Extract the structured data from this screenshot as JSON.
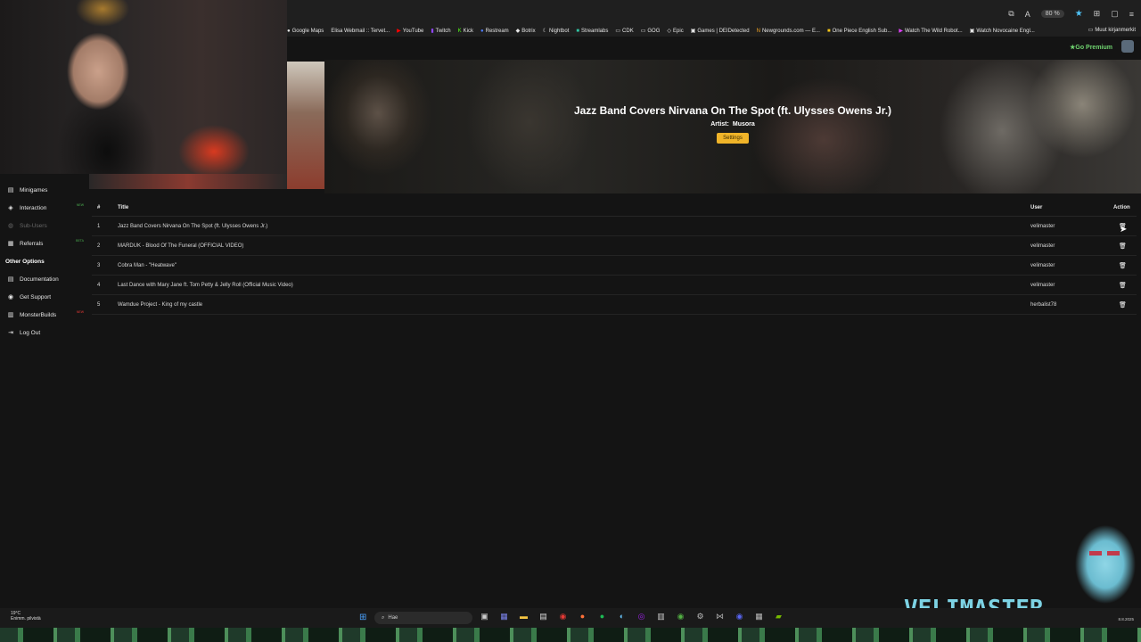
{
  "browser": {
    "zoom": "80 %",
    "bookmarks": [
      "Google Maps",
      "Elisa Webmail :: Tervet...",
      "YouTube",
      "Twitch",
      "Kick",
      "Restream",
      "Botrix",
      "Nightbot",
      "Streamlabs",
      "CDK",
      "GOG",
      "Epic",
      "Games | DEIDetected",
      "Newgrounds.com — E...",
      "One Piece English Sub...",
      "Watch The Wild Robot...",
      "Watch Novocaine Engl..."
    ],
    "other_bookmarks": "Muut kirjanmerkit"
  },
  "header": {
    "premium_label": "Go Premium"
  },
  "hero": {
    "title": "Jazz Band Covers Nirvana On The Spot (ft. Ulysses Owens Jr.)",
    "artist_label": "Artist:",
    "artist_value": "Musora",
    "settings_label": "Settings"
  },
  "sidebar": {
    "items": [
      {
        "label": "Minigames",
        "icon": "gamepad-icon"
      },
      {
        "label": "Interaction",
        "icon": "interaction-icon",
        "badge": "NEW"
      },
      {
        "label": "Sub-Users",
        "icon": "users-icon"
      },
      {
        "label": "Referrals",
        "icon": "referrals-icon",
        "badge": "BETA"
      }
    ],
    "section_title": "Other Options",
    "other_items": [
      {
        "label": "Documentation",
        "icon": "document-icon"
      },
      {
        "label": "Get Support",
        "icon": "support-icon"
      },
      {
        "label": "MonsterBuilds",
        "icon": "builds-icon",
        "badge": "NEW"
      },
      {
        "label": "Log Out",
        "icon": "logout-icon"
      }
    ]
  },
  "table": {
    "columns": {
      "num": "#",
      "title": "Title",
      "user": "User",
      "action": "Action"
    },
    "rows": [
      {
        "num": "1",
        "title": "Jazz Band Covers Nirvana On The Spot (ft. Ulysses Owens Jr.)",
        "user": "velimaster"
      },
      {
        "num": "2",
        "title": "MARDUK - Blood Of The Funeral (OFFICIAL VIDEO)",
        "user": "velimaster"
      },
      {
        "num": "3",
        "title": "Cobra Man - \"Heatwave\"",
        "user": "velimaster"
      },
      {
        "num": "4",
        "title": "Last Dance with Mary Jane ft. Tom Petty & Jelly Roll (Official Music Video)",
        "user": "velimaster"
      },
      {
        "num": "5",
        "title": "Wamdue Project - King of my castle",
        "user": "herbalist78"
      }
    ]
  },
  "watermark": {
    "logo": "VELIMASTER"
  },
  "taskbar": {
    "temperature": "19°C",
    "weather": "Enimm. pilvistä",
    "search_placeholder": "Hae",
    "date": "8.8.2025"
  }
}
